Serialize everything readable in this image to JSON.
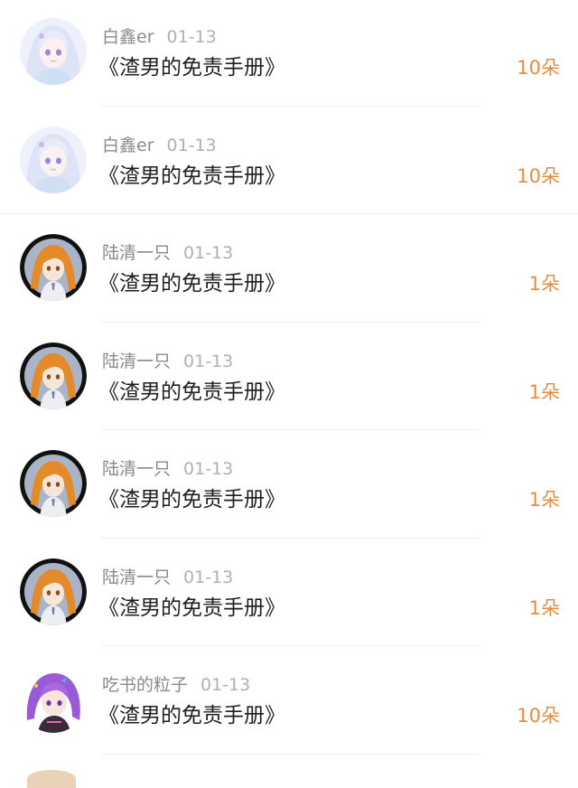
{
  "rows": [
    {
      "user": "白鑫er",
      "date": "01-13",
      "title": "《渣男的免责手册》",
      "amount": "10朵",
      "avatar": "anime-girl-white-hair-avatar",
      "divider": "short"
    },
    {
      "user": "白鑫er",
      "date": "01-13",
      "title": "《渣男的免责手册》",
      "amount": "10朵",
      "avatar": "anime-girl-white-hair-avatar",
      "divider": "full"
    },
    {
      "user": "陆清一只",
      "date": "01-13",
      "title": "《渣男的免责手册》",
      "amount": "1朵",
      "avatar": "anime-girl-orange-hair-avatar",
      "divider": "short"
    },
    {
      "user": "陆清一只",
      "date": "01-13",
      "title": "《渣男的免责手册》",
      "amount": "1朵",
      "avatar": "anime-girl-orange-hair-avatar",
      "divider": "short"
    },
    {
      "user": "陆清一只",
      "date": "01-13",
      "title": "《渣男的免责手册》",
      "amount": "1朵",
      "avatar": "anime-girl-orange-hair-avatar",
      "divider": "short"
    },
    {
      "user": "陆清一只",
      "date": "01-13",
      "title": "《渣男的免责手册》",
      "amount": "1朵",
      "avatar": "anime-girl-orange-hair-avatar",
      "divider": "short"
    },
    {
      "user": "吃书的粒子",
      "date": "01-13",
      "title": "《渣男的免责手册》",
      "amount": "10朵",
      "avatar": "anime-girl-purple-hair-avatar",
      "divider": "short"
    }
  ],
  "colors": {
    "amount": "#ec8a3c",
    "username": "#8a8a8a",
    "date": "#b0b0b0",
    "title": "#1f1f1f"
  }
}
